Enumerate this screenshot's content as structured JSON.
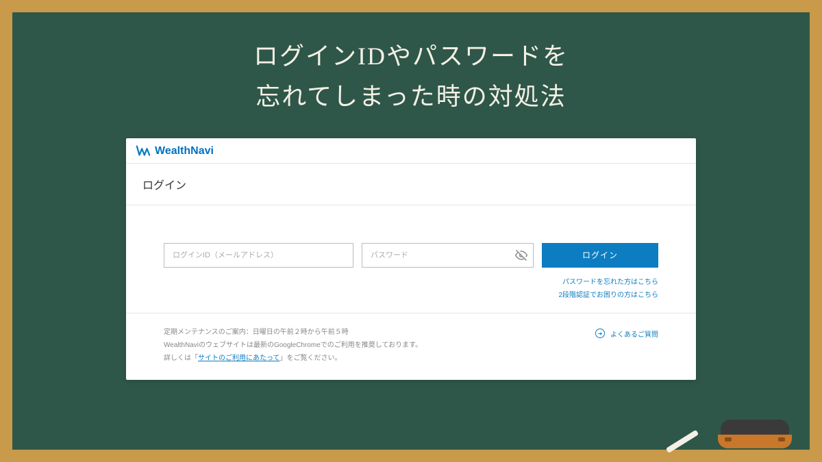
{
  "title": {
    "line1": "ログインIDやパスワードを",
    "line2": "忘れてしまった時の対処法"
  },
  "brand": {
    "name": "WealthNavi"
  },
  "page": {
    "heading": "ログイン"
  },
  "form": {
    "login_id_placeholder": "ログインID（メールアドレス）",
    "password_placeholder": "パスワード",
    "submit_label": "ログイン"
  },
  "links": {
    "forgot_password": "パスワードを忘れた方はこちら",
    "two_factor_help": "2段階認証でお困りの方はこちら",
    "faq": "よくあるご質問",
    "site_usage": "サイトのご利用にあたって"
  },
  "footer": {
    "maintenance": "定期メンテナンスのご案内：日曜日の午前２時から午前５時",
    "browser_note": "WealthNaviのウェブサイトは最新のGoogleChromeでのご利用を推奨しております。",
    "detail_prefix": "詳しくは「",
    "detail_suffix": "」をご覧ください。"
  }
}
